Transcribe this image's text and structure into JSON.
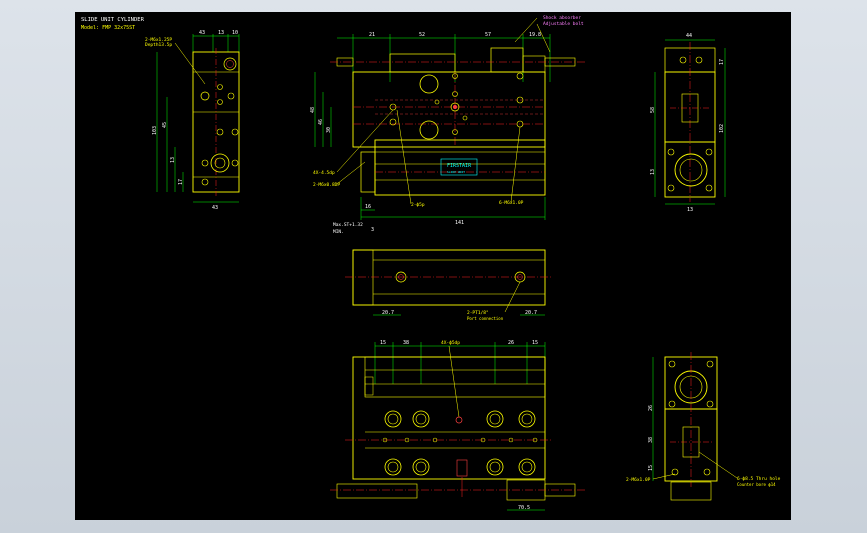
{
  "title_block": {
    "line1": "SLIDE UNIT CYLINDER",
    "line2": "Model: FMP 32x75ST"
  },
  "colors": {
    "background": "#000000",
    "outline": "#ffff00",
    "dimension": "#00ff00",
    "centerline": "#ff2020",
    "hidden": "#ff4040",
    "hole": "#ffff00",
    "text": "#ffffff",
    "label": "#ff80ff",
    "brand": "#00ffff"
  },
  "front_view": {
    "dims_top": [
      "21",
      "52",
      "57",
      "19.8"
    ],
    "dims_left": [
      "48",
      "46",
      "30"
    ],
    "bottom_dims": [
      "141",
      "16",
      "3"
    ],
    "stroke_note1": "Max.ST+1.32",
    "stroke_note2": "MIN.",
    "callouts": [
      "4X-4.5dp",
      "2-M6x0.8DP",
      "2-ϕ5p",
      "6-M6x1.0P"
    ],
    "legend1": "Shock absorber",
    "legend2": "Adjustable bolt",
    "brand_text": "FIRSTAIR",
    "brand_sub": "SLIDE UNIT"
  },
  "left_view": {
    "dims_top": [
      "43",
      "13",
      "10"
    ],
    "dims_left": [
      "103",
      "45",
      "13",
      "17"
    ],
    "dim_bottom": "43",
    "callout1": "2-M6x1.25P",
    "callout2": "Depth13.5p"
  },
  "right_view": {
    "dim_top": "44",
    "dims_right": [
      "90",
      "102",
      "17"
    ],
    "dims_left": [
      "58",
      "13"
    ],
    "dim_bottom": "13"
  },
  "mid_view": {
    "dims": [
      "20.7",
      "20.7"
    ],
    "callout1": "2-PT1/8\"",
    "callout2": "Port connection"
  },
  "bottom_view": {
    "dims_top": [
      "15",
      "38",
      "26",
      "15"
    ],
    "callout_top": "4X-ϕ5dp",
    "dim_bottom": "70.5"
  },
  "side_view2": {
    "dims_left": [
      "26",
      "38",
      "15"
    ],
    "callout1": "2-M6x1.0P",
    "callout2": "6-ϕ8.5 Thru hole",
    "callout3": "Counter bore ϕ14"
  }
}
